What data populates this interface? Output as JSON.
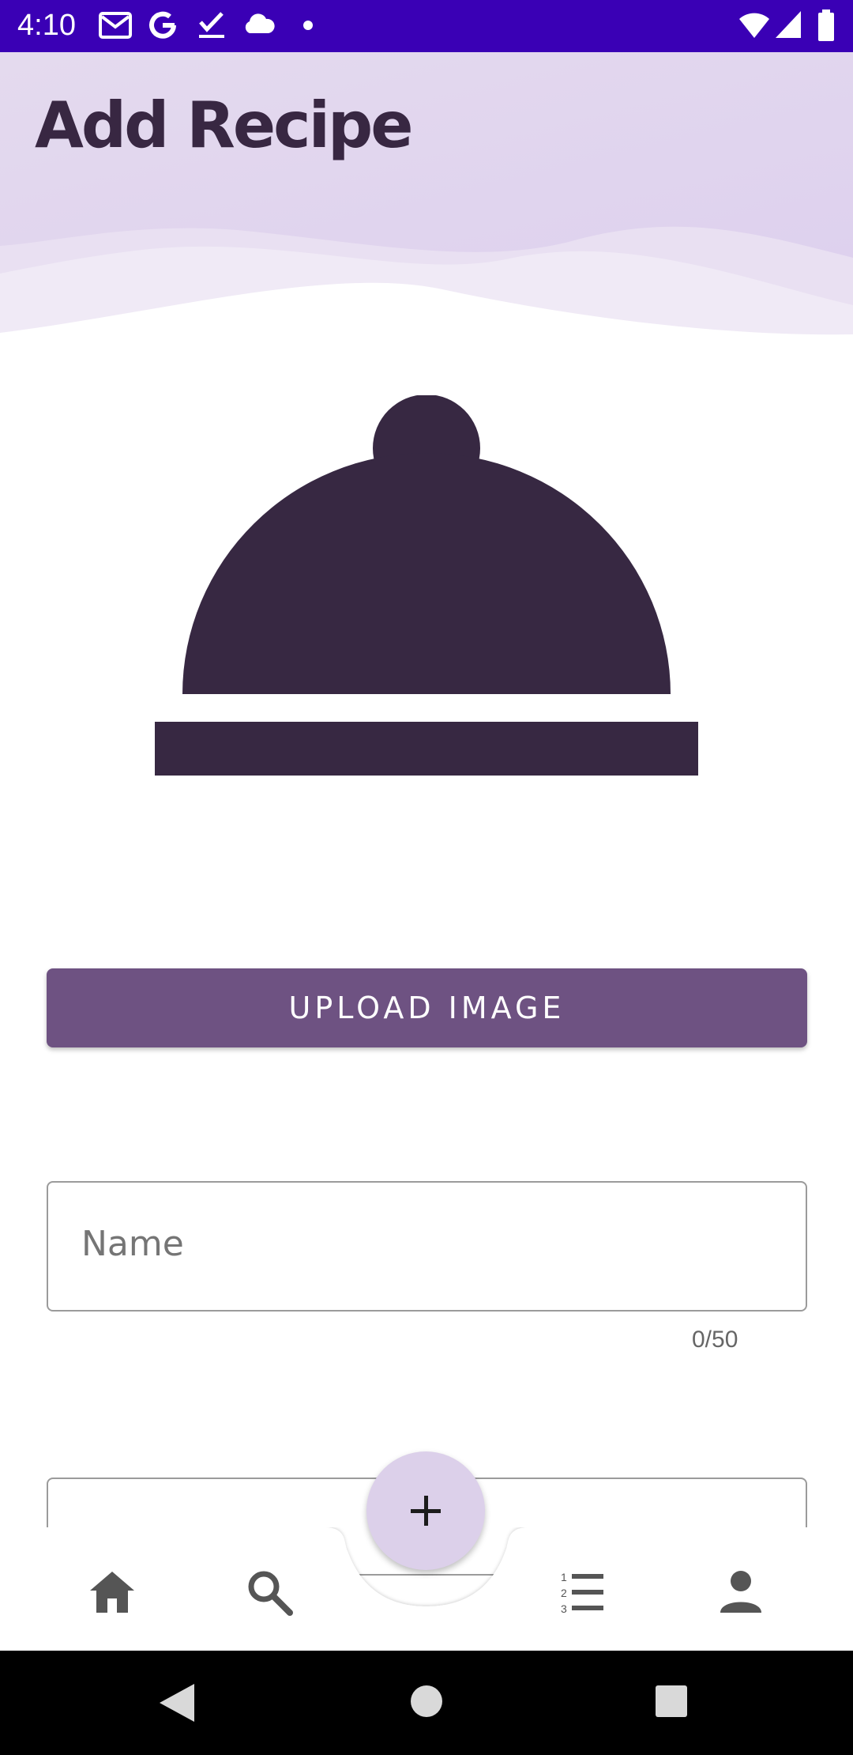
{
  "status_bar": {
    "time": "4:10",
    "notification_icons": [
      "gmail-icon",
      "google-icon",
      "tasks-check-icon",
      "cloud-icon",
      "dot-icon"
    ],
    "system_icons": [
      "wifi-icon",
      "signal-icon",
      "battery-icon"
    ]
  },
  "header": {
    "title": "Add Recipe"
  },
  "image_placeholder": {
    "icon": "cloche-icon",
    "color": "#372842"
  },
  "upload_button": {
    "label": "UPLOAD IMAGE",
    "color": "#6E5282"
  },
  "name_field": {
    "placeholder": "Name",
    "counter": "0/50"
  },
  "fab": {
    "icon": "plus-icon",
    "color": "#DCD0EA"
  },
  "bottom_nav": {
    "items": [
      "home-icon",
      "search-icon",
      "list-numbered-icon",
      "person-icon"
    ]
  },
  "colors": {
    "status_bar": "#3A00B5",
    "header": "#E2D6EE",
    "accent": "#6E5282"
  }
}
